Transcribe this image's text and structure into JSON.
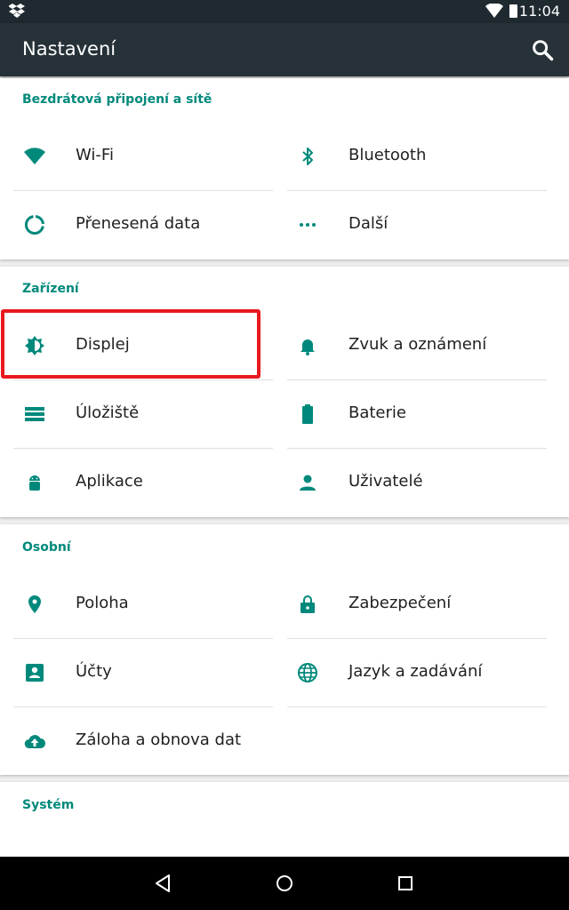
{
  "status": {
    "time": "11:04",
    "icons": [
      "dropbox-icon",
      "wifi-icon",
      "battery-icon"
    ]
  },
  "appbar": {
    "title": "Nastavení",
    "search_icon": "search-icon"
  },
  "sections": {
    "wireless": {
      "title": "Bezdrátová připojení a sítě",
      "items": [
        "Wi-Fi",
        "Bluetooth",
        "Přenesená data",
        "Další"
      ]
    },
    "device": {
      "title": "Zařízení",
      "items": [
        "Displej",
        "Zvuk a oznámení",
        "Úložiště",
        "Baterie",
        "Aplikace",
        "Uživatelé"
      ]
    },
    "personal": {
      "title": "Osobní",
      "items": [
        "Poloha",
        "Zabezpečení",
        "Účty",
        "Jazyk a zadávání",
        "Záloha a obnova dat"
      ]
    },
    "system": {
      "title": "Systém"
    }
  },
  "navbar": {
    "buttons": [
      "back-icon",
      "home-icon",
      "recents-icon"
    ]
  },
  "colors": {
    "accent": "#00897b",
    "appbar": "#263238",
    "statusbar": "#1f2a30",
    "highlight": "#e8191f"
  }
}
